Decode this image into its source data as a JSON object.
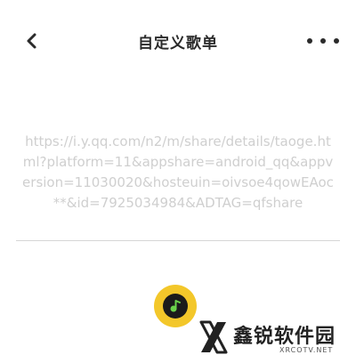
{
  "header": {
    "title": "自定义歌单",
    "back_icon": "chevron-left-icon",
    "more_icon": "more-horizontal-icon"
  },
  "content": {
    "url_text": "https://i.y.qq.com/n2/m/share/details/taoge.html?platform=11&appshare=android_qq&appversion=11030020&hosteuin=oivsoe4qowEAoc**&id=7925034984&ADTAG=qfshare"
  },
  "fab": {
    "icon": "music-note-icon",
    "color": "#f3c72a"
  },
  "watermark": {
    "name": "鑫锐软件园",
    "site": "XRCOTV.NET"
  }
}
